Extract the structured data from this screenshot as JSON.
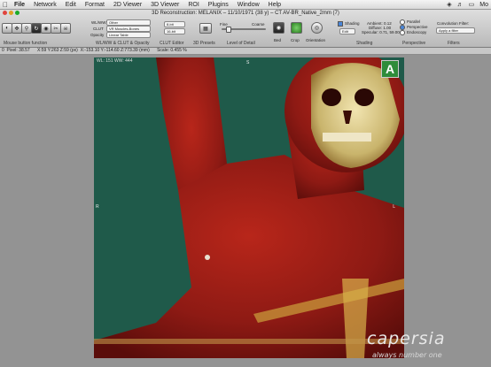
{
  "menubar": {
    "apple_icon": "apple-icon",
    "items": [
      "File",
      "Network",
      "Edit",
      "Format",
      "2D Viewer",
      "3D Viewer",
      "ROI",
      "Plugins",
      "Window",
      "Help"
    ],
    "right_status": "Mo"
  },
  "window": {
    "title": "3D Reconstruction: MELANIX – 11/10/1971 (38 y) – CT AV-BR_Native_2mm (7)"
  },
  "toolbar": {
    "mouse_caption": "Mouse button function",
    "wlww_caption": "WL/WW & CLUT & Opacity",
    "clut_editor_caption": "CLUT Editor",
    "presets_caption": "3D Presets",
    "lod_caption": "Level of Detail",
    "bed_label": "Bed",
    "crop_label": "Crop",
    "orientation_label": "Orientation",
    "shading_caption": "Shading",
    "perspective_caption": "Perspective",
    "filters_caption": "Filters",
    "wlww_label": "WL/WW",
    "wlww_value": "Other",
    "clut_label": "CLUT",
    "clut_value": "VR Muscles-Bones",
    "opacity_label": "Opacity",
    "opacity_value": "Linear Table",
    "bit1": "8-bit",
    "bit2": "16-bit",
    "lod_fine": "Fine",
    "lod_coarse": "Coarse",
    "shading_label": "Shading",
    "edit_label": "Edit",
    "ambient": "Ambient: 0.12",
    "diffuse": "Diffuse: 1.00",
    "specular": "Specular: 0.71, 59.00",
    "persp_parallel": "Parallel",
    "persp_perspective": "Perspective",
    "persp_endoscopy": "Endoscopy",
    "convolution_label": "Convolution Filter:",
    "apply_filter": "Apply a filter"
  },
  "status": {
    "text": "0  Pixel: 38.57      X:59 Y:263 Z:59 (px)  X:-153.10 Y:-114.60 Z:773.39 (mm)      Scale: 0.455 %"
  },
  "viewport": {
    "wlww_overlay": "WL: 151 WW: 444",
    "top_marker": "S",
    "left_marker": "R",
    "right_marker": "L",
    "orientation_cube": "A",
    "colors": {
      "background": "#1f5a4a",
      "tissue": "#8e1a14",
      "bone": "#d9c98c"
    }
  },
  "watermark": {
    "brand": "capersia",
    "tagline": "always number one"
  }
}
